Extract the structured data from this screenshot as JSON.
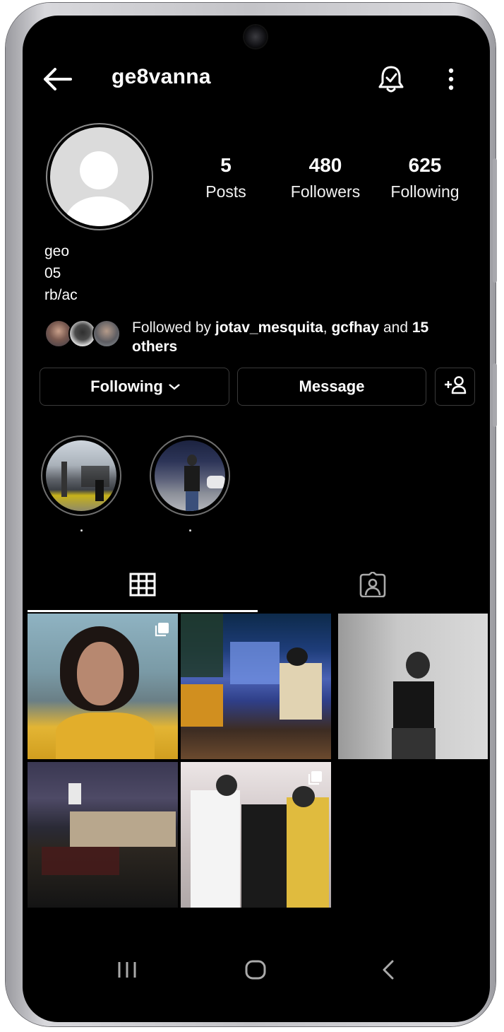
{
  "header": {
    "username": "ge8vanna"
  },
  "stats": [
    {
      "value": "5",
      "label": "Posts"
    },
    {
      "value": "480",
      "label": "Followers"
    },
    {
      "value": "625",
      "label": "Following"
    }
  ],
  "bio": {
    "line1": "geo",
    "line2": "05",
    "line3": "rb/ac"
  },
  "followed_by": {
    "prefix": "Followed by ",
    "user1": "jotav_mesquita",
    "sep": ", ",
    "user2": "gcfhay",
    "mid": " and ",
    "count": "15",
    "suffix": "others"
  },
  "actions": {
    "following_label": "Following",
    "message_label": "Message"
  },
  "icons": {
    "back": "arrow-left-icon",
    "bell": "notification-bell-icon",
    "more": "more-vertical-icon",
    "add_person": "add-person-icon",
    "grid": "grid-icon",
    "tagged": "tagged-person-icon",
    "multi": "multiple-photos-icon"
  },
  "colors": {
    "background": "#000000",
    "text": "#ffffff",
    "border": "#3a3a3a"
  }
}
